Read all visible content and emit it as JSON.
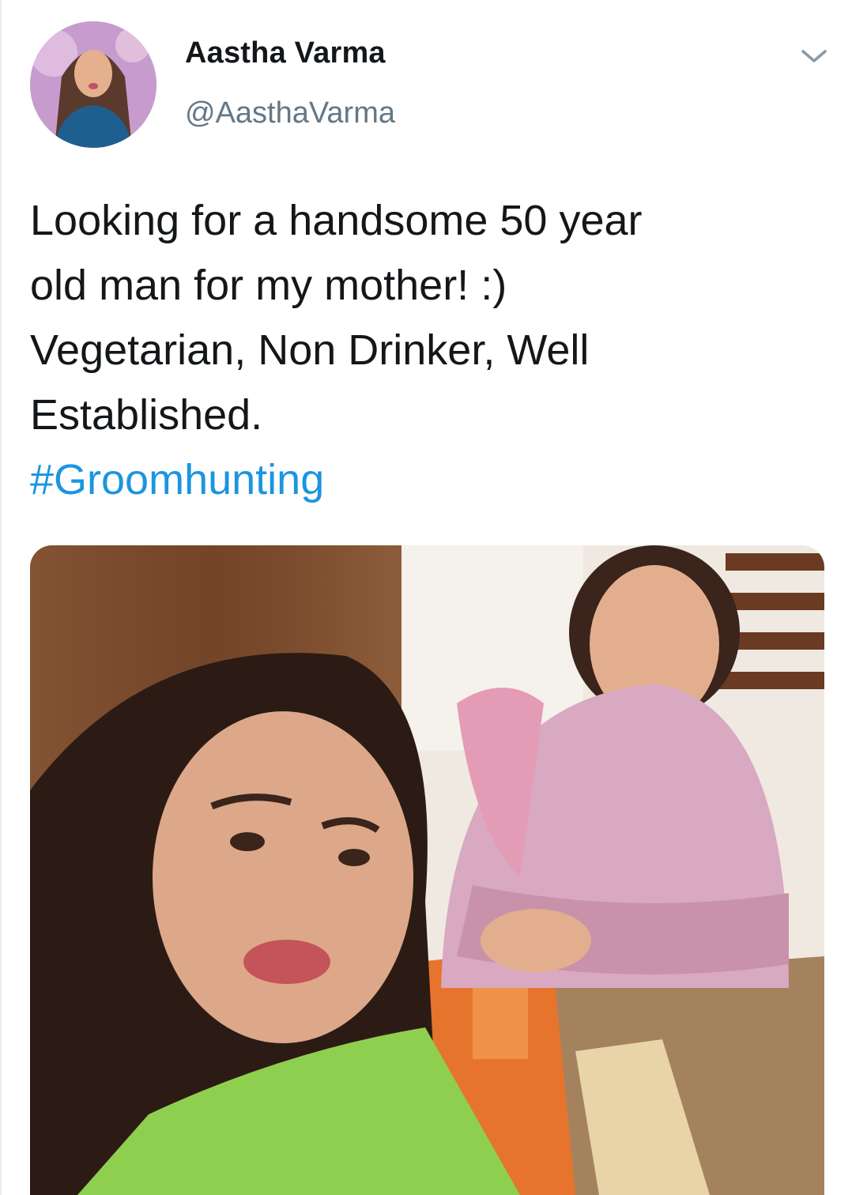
{
  "tweet": {
    "author_name": "Aastha Varma",
    "author_handle": "@AasthaVarma",
    "text_lines": [
      "Looking for a handsome 50 year",
      "old man for my mother! :)",
      "Vegetarian, Non Drinker, Well",
      "Established."
    ],
    "hashtag": "#Groomhunting"
  },
  "icons": {
    "menu": "chevron-down-icon"
  },
  "colors": {
    "text": "#14171a",
    "secondary": "#657786",
    "link": "#1b95e0"
  }
}
